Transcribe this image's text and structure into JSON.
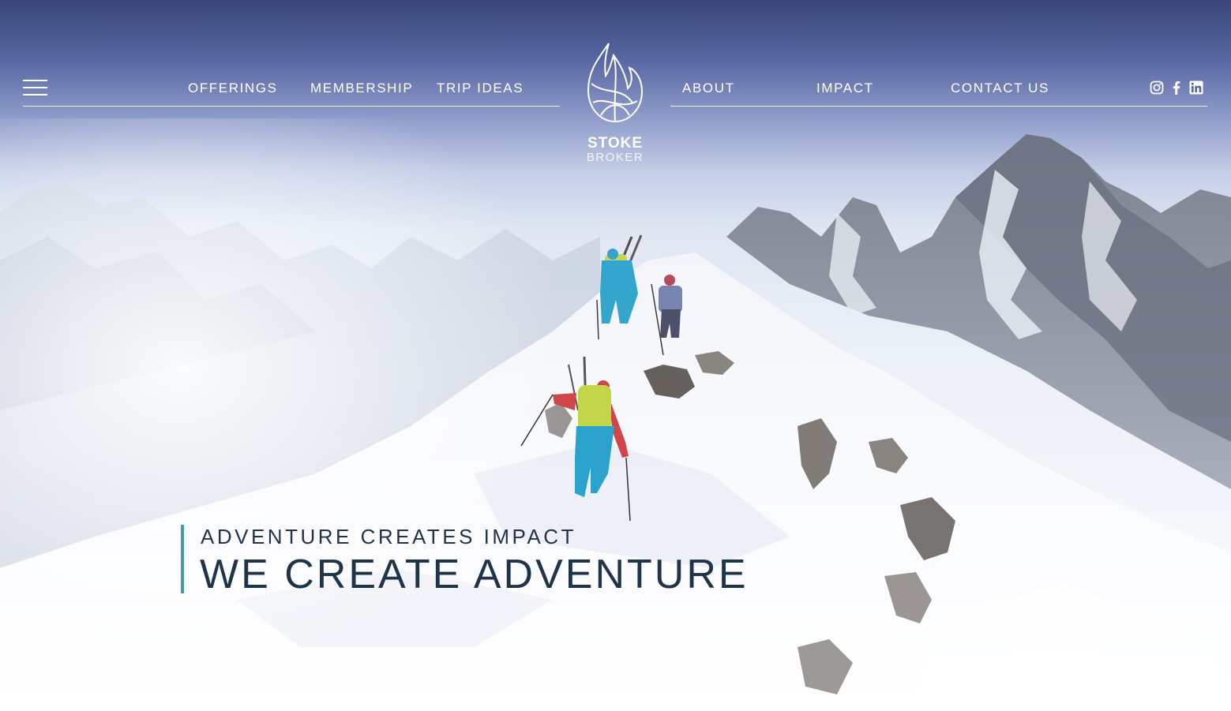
{
  "nav": {
    "left_items": [
      {
        "label": "OFFERINGS"
      },
      {
        "label": "MEMBERSHIP"
      },
      {
        "label": "TRIP IDEAS"
      }
    ],
    "right_items": [
      {
        "label": "ABOUT"
      },
      {
        "label": "IMPACT"
      },
      {
        "label": "CONTACT US"
      }
    ],
    "social_icons": [
      "instagram-icon",
      "facebook-icon",
      "linkedin-icon"
    ]
  },
  "logo": {
    "word1": "STOKE",
    "word2": "BROKER"
  },
  "hero": {
    "subtitle": "ADVENTURE CREATES IMPACT",
    "title": "WE CREATE ADVENTURE",
    "accent_color": "#4a97a6",
    "text_color": "#1f3349"
  }
}
